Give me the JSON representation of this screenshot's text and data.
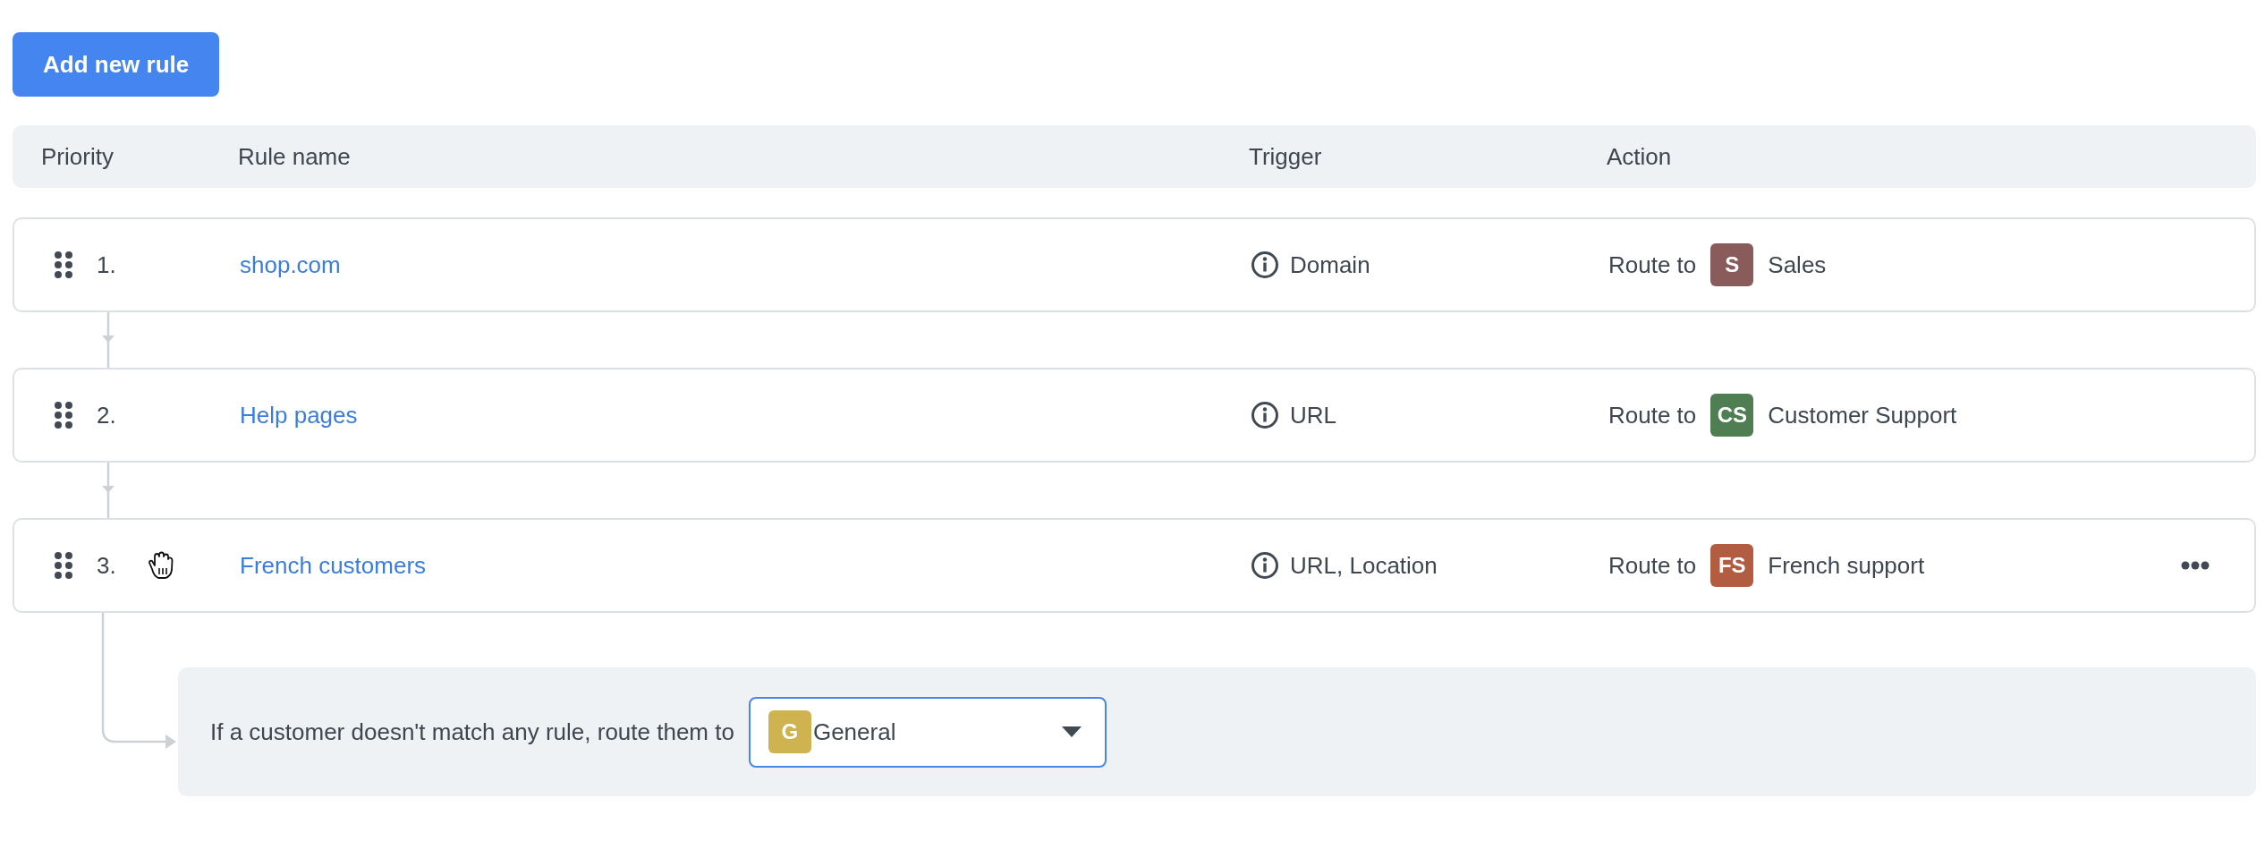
{
  "add_button": {
    "label": "Add new rule"
  },
  "columns": [
    "Priority",
    "Rule name",
    "Trigger",
    "Action"
  ],
  "rules": [
    {
      "priority": "1.",
      "name": "shop.com",
      "trigger": "Domain",
      "action": "Route to",
      "team": {
        "initials": "S",
        "name": "Sales",
        "color": "#8a5b5b"
      },
      "hovered": false
    },
    {
      "priority": "2.",
      "name": "Help pages",
      "trigger": "URL",
      "action": "Route to",
      "team": {
        "initials": "CS",
        "name": "Customer Support",
        "color": "#4f7e53"
      },
      "hovered": false
    },
    {
      "priority": "3.",
      "name": "French customers",
      "trigger": "URL, Location",
      "action": "Route to",
      "team": {
        "initials": "FS",
        "name": "French support",
        "color": "#b25c42"
      },
      "hovered": true
    }
  ],
  "fallback": {
    "text": "If a customer doesn't match any rule, route them to",
    "team": {
      "initials": "G",
      "name": "General",
      "color": "#cfb350"
    }
  }
}
